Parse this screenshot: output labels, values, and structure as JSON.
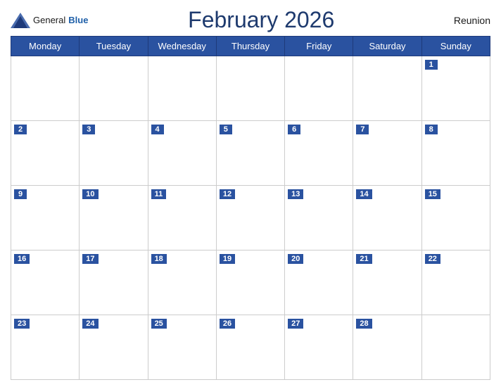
{
  "header": {
    "logo_general": "General",
    "logo_blue": "Blue",
    "title": "February 2026",
    "region": "Reunion"
  },
  "weekdays": [
    "Monday",
    "Tuesday",
    "Wednesday",
    "Thursday",
    "Friday",
    "Saturday",
    "Sunday"
  ],
  "weeks": [
    [
      null,
      null,
      null,
      null,
      null,
      null,
      1
    ],
    [
      2,
      3,
      4,
      5,
      6,
      7,
      8
    ],
    [
      9,
      10,
      11,
      12,
      13,
      14,
      15
    ],
    [
      16,
      17,
      18,
      19,
      20,
      21,
      22
    ],
    [
      23,
      24,
      25,
      26,
      27,
      28,
      null
    ]
  ]
}
